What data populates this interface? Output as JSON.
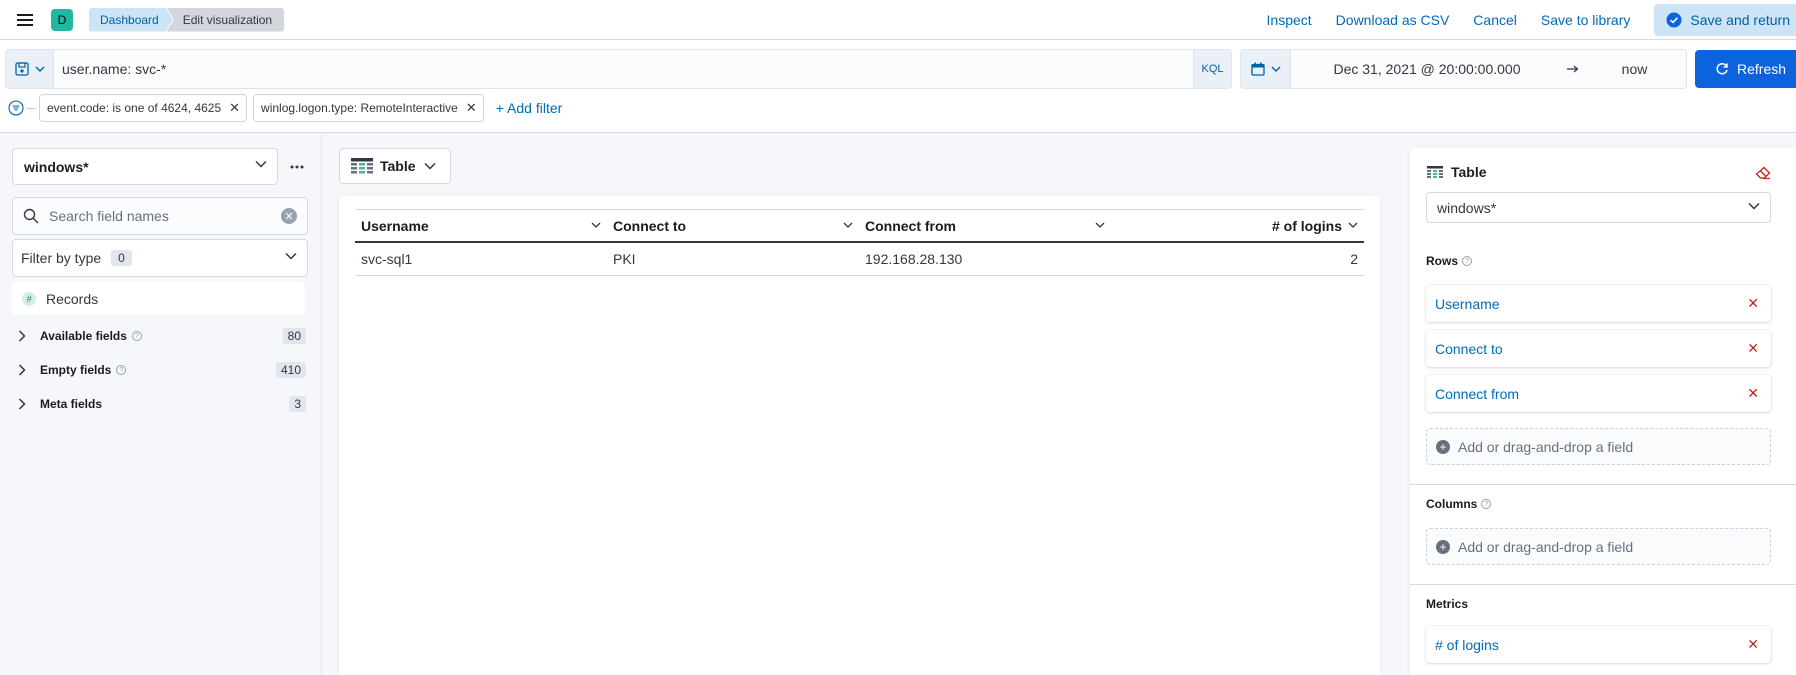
{
  "header": {
    "space_initial": "D",
    "breadcrumbs": [
      "Dashboard",
      "Edit visualization"
    ],
    "actions": {
      "inspect": "Inspect",
      "download": "Download as CSV",
      "cancel": "Cancel",
      "save_library": "Save to library",
      "save_return": "Save and return"
    }
  },
  "query": {
    "text": "user.name: svc-*",
    "language": "KQL",
    "date_start": "Dec 31, 2021 @ 20:00:00.000",
    "date_end": "now",
    "refresh_label": "Refresh",
    "filters": [
      "event.code: is one of 4624, 4625",
      "winlog.logon.type: RemoteInteractive"
    ],
    "add_filter": "+ Add filter"
  },
  "sidebar": {
    "data_view": "windows*",
    "search_placeholder": "Search field names",
    "filter_by_type": "Filter by type",
    "filter_count": "0",
    "records_label": "Records",
    "sections": [
      {
        "label": "Available fields",
        "count": "80",
        "help": true
      },
      {
        "label": "Empty fields",
        "count": "410",
        "help": true
      },
      {
        "label": "Meta fields",
        "count": "3",
        "help": false
      }
    ]
  },
  "workspace": {
    "vis_type": "Table",
    "table": {
      "columns": [
        "Username",
        "Connect to",
        "Connect from",
        "# of logins"
      ],
      "rows": [
        [
          "svc-sql1",
          "PKI",
          "192.168.28.130",
          "2"
        ]
      ]
    }
  },
  "config": {
    "title": "Table",
    "data_view": "windows*",
    "rows_title": "Rows",
    "rows": [
      "Username",
      "Connect to",
      "Connect from"
    ],
    "add_field": "Add or drag-and-drop a field",
    "columns_title": "Columns",
    "metrics_title": "Metrics",
    "metrics": [
      "# of logins"
    ]
  },
  "colors": {
    "primary": "#0b64dd",
    "link": "#006bb8",
    "danger": "#bd271e",
    "avatar": "#20b89f"
  }
}
